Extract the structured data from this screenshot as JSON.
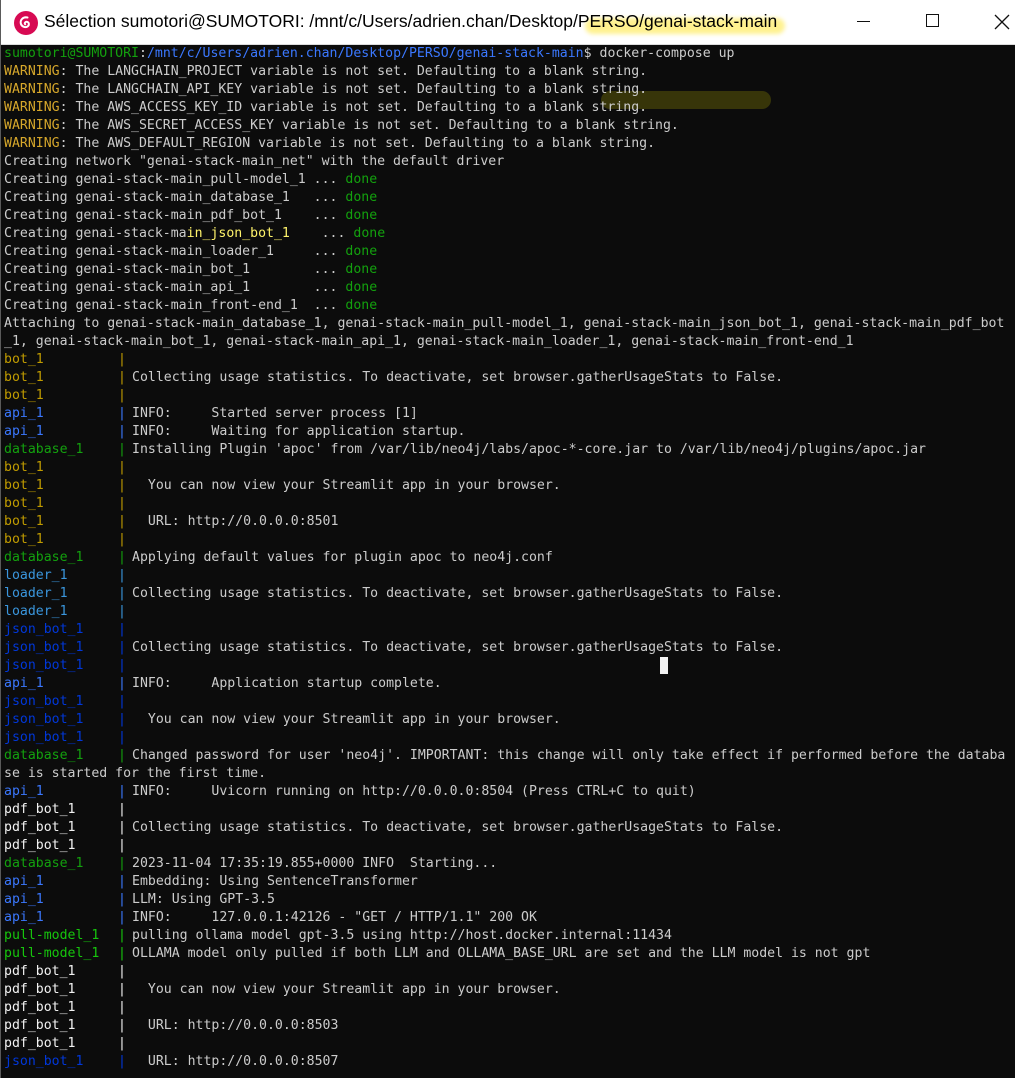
{
  "window": {
    "title": "Sélection sumotori@SUMOTORI: /mnt/c/Users/adrien.chan/Desktop/PERSO/genai-stack-main",
    "app_icon": "debian-swirl-icon",
    "controls": {
      "minimize": "minimize-icon",
      "maximize": "maximize-icon",
      "close": "close-icon"
    }
  },
  "prompt": {
    "user_host": "sumotori@SUMOTORI",
    "separator": ":",
    "path": "/mnt/c/Users/adrien.chan/Desktop/PERSO/genai-stack-main",
    "symbol": "$ ",
    "command": "docker-compose up"
  },
  "warnings": [
    {
      "tag": "WARNING",
      "text": ": The LANGCHAIN_PROJECT variable is not set. Defaulting to a blank string."
    },
    {
      "tag": "WARNING",
      "text": ": The LANGCHAIN_API_KEY variable is not set. Defaulting to a blank string."
    },
    {
      "tag": "WARNING",
      "text": ": The AWS_ACCESS_KEY_ID variable is not set. Defaulting to a blank string."
    },
    {
      "tag": "WARNING",
      "text": ": The AWS_SECRET_ACCESS_KEY variable is not set. Defaulting to a blank string."
    },
    {
      "tag": "WARNING",
      "text": ": The AWS_DEFAULT_REGION variable is not set. Defaulting to a blank string."
    }
  ],
  "network_line": "Creating network \"genai-stack-main_net\" with the default driver",
  "creating": [
    {
      "text": "Creating genai-stack-main_pull-model_1 ... ",
      "status": "done"
    },
    {
      "text": "Creating genai-stack-main_database_1   ... ",
      "status": "done"
    },
    {
      "text": "Creating genai-stack-main_pdf_bot_1    ... ",
      "status": "done"
    },
    {
      "pre": "Creating genai-stack-ma",
      "hl": "in_json_bot_1",
      "post": "    ... ",
      "status": "done"
    },
    {
      "text": "Creating genai-stack-main_loader_1     ... ",
      "status": "done"
    },
    {
      "text": "Creating genai-stack-main_bot_1        ... ",
      "status": "done"
    },
    {
      "text": "Creating genai-stack-main_api_1        ... ",
      "status": "done"
    },
    {
      "text": "Creating genai-stack-main_front-end_1  ... ",
      "status": "done"
    }
  ],
  "attaching": [
    "Attaching to genai-stack-main_database_1, genai-stack-main_pull-model_1, genai-stack-main_json_bot_1, genai-stack-main_pdf_bot",
    "_1, genai-stack-main_bot_1, genai-stack-main_api_1, genai-stack-main_loader_1, genai-stack-main_front-end_1"
  ],
  "logs": [
    {
      "svc": "bot_1",
      "cls": "c-bot",
      "msg": ""
    },
    {
      "svc": "bot_1",
      "cls": "c-bot",
      "msg": "Collecting usage statistics. To deactivate, set browser.gatherUsageStats to False."
    },
    {
      "svc": "bot_1",
      "cls": "c-bot",
      "msg": ""
    },
    {
      "svc": "api_1",
      "cls": "c-api",
      "msg": "INFO:     Started server process [1]"
    },
    {
      "svc": "api_1",
      "cls": "c-api",
      "msg": "INFO:     Waiting for application startup."
    },
    {
      "svc": "database_1",
      "cls": "c-db",
      "msg": "Installing Plugin 'apoc' from /var/lib/neo4j/labs/apoc-*-core.jar to /var/lib/neo4j/plugins/apoc.jar"
    },
    {
      "svc": "bot_1",
      "cls": "c-bot",
      "msg": ""
    },
    {
      "svc": "bot_1",
      "cls": "c-bot",
      "msg": "  You can now view your Streamlit app in your browser."
    },
    {
      "svc": "bot_1",
      "cls": "c-bot",
      "msg": ""
    },
    {
      "svc": "bot_1",
      "cls": "c-bot",
      "msg": "  URL: http://0.0.0.0:8501"
    },
    {
      "svc": "bot_1",
      "cls": "c-bot",
      "msg": ""
    },
    {
      "svc": "database_1",
      "cls": "c-db",
      "msg": "Applying default values for plugin apoc to neo4j.conf"
    },
    {
      "svc": "loader_1",
      "cls": "c-loader",
      "msg": ""
    },
    {
      "svc": "loader_1",
      "cls": "c-loader",
      "msg": "Collecting usage statistics. To deactivate, set browser.gatherUsageStats to False."
    },
    {
      "svc": "loader_1",
      "cls": "c-loader",
      "msg": ""
    },
    {
      "svc": "json_bot_1",
      "cls": "c-json",
      "msg": ""
    },
    {
      "svc": "json_bot_1",
      "cls": "c-json",
      "msg": "Collecting usage statistics. To deactivate, set browser.gatherUsageStats to False."
    },
    {
      "svc": "json_bot_1",
      "cls": "c-json",
      "msg": ""
    },
    {
      "svc": "api_1",
      "cls": "c-api",
      "msg": "INFO:     Application startup complete."
    },
    {
      "svc": "json_bot_1",
      "cls": "c-json",
      "msg": ""
    },
    {
      "svc": "json_bot_1",
      "cls": "c-json",
      "msg": "  You can now view your Streamlit app in your browser."
    },
    {
      "svc": "json_bot_1",
      "cls": "c-json",
      "msg": ""
    },
    {
      "svc": "database_1",
      "cls": "c-db",
      "msg": "Changed password for user 'neo4j'. IMPORTANT: this change will only take effect if performed before the databa"
    },
    {
      "svc": "",
      "cls": "",
      "msg": "se is started for the first time.",
      "raw": true
    },
    {
      "svc": "api_1",
      "cls": "c-api",
      "msg": "INFO:     Uvicorn running on http://0.0.0.0:8504 (Press CTRL+C to quit)"
    },
    {
      "svc": "pdf_bot_1",
      "cls": "c-pdf",
      "msg": ""
    },
    {
      "svc": "pdf_bot_1",
      "cls": "c-pdf",
      "msg": "Collecting usage statistics. To deactivate, set browser.gatherUsageStats to False."
    },
    {
      "svc": "pdf_bot_1",
      "cls": "c-pdf",
      "msg": ""
    },
    {
      "svc": "database_1",
      "cls": "c-db",
      "msg": "2023-11-04 17:35:19.855+0000 INFO  Starting..."
    },
    {
      "svc": "api_1",
      "cls": "c-api",
      "msg": "Embedding: Using SentenceTransformer"
    },
    {
      "svc": "api_1",
      "cls": "c-api",
      "msg": "LLM: Using GPT-3.5"
    },
    {
      "svc": "api_1",
      "cls": "c-api",
      "msg": "INFO:     127.0.0.1:42126 - \"GET / HTTP/1.1\" 200 OK"
    },
    {
      "svc": "pull-model_1",
      "cls": "c-pull",
      "msg": "pulling ollama model gpt-3.5 using http://host.docker.internal:11434"
    },
    {
      "svc": "pull-model_1",
      "cls": "c-pull",
      "msg": "OLLAMA model only pulled if both LLM and OLLAMA_BASE_URL are set and the LLM model is not gpt"
    },
    {
      "svc": "pdf_bot_1",
      "cls": "c-pdf",
      "msg": ""
    },
    {
      "svc": "pdf_bot_1",
      "cls": "c-pdf",
      "msg": "  You can now view your Streamlit app in your browser."
    },
    {
      "svc": "pdf_bot_1",
      "cls": "c-pdf",
      "msg": ""
    },
    {
      "svc": "pdf_bot_1",
      "cls": "c-pdf",
      "msg": "  URL: http://0.0.0.0:8503"
    },
    {
      "svc": "pdf_bot_1",
      "cls": "c-pdf",
      "msg": ""
    },
    {
      "svc": "json_bot_1",
      "cls": "c-json",
      "msg": "  URL: http://0.0.0.0:8507"
    }
  ],
  "colors": {
    "warning": "#d6a72b",
    "done": "#13a10e",
    "prompt_user": "#13a10e",
    "prompt_path": "#3b78ff",
    "bot": "#c19c00",
    "api": "#3b78ff",
    "database": "#13a10e",
    "loader": "#3a96dd",
    "json_bot": "#0037da",
    "pdf_bot": "#f2f2f2",
    "pull_model": "#16c60c",
    "background": "#0c0c0c",
    "text": "#cccccc"
  }
}
